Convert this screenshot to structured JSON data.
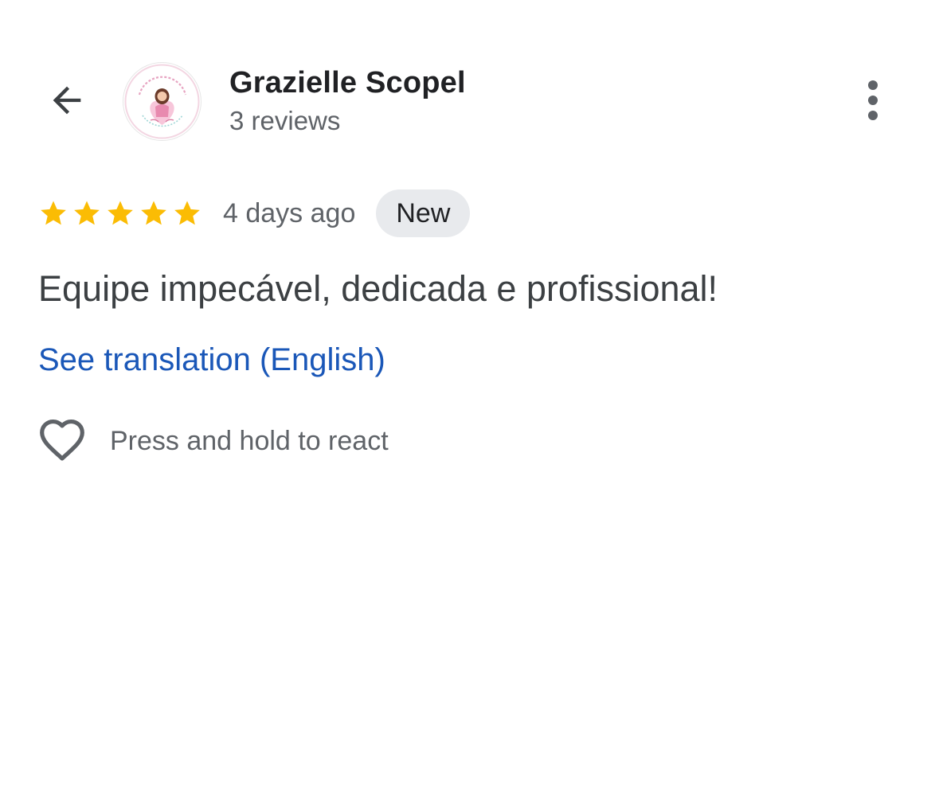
{
  "header": {
    "back_icon": "arrow-back-icon",
    "avatar_icon": "profile-avatar-icon",
    "reviewer_name": "Grazielle Scopel",
    "review_count": "3 reviews",
    "more_icon": "more-vertical-icon"
  },
  "review": {
    "rating": 5,
    "rating_max": 5,
    "star_icon": "star-icon",
    "star_color": "#fbbc04",
    "date": "4 days ago",
    "badge": "New",
    "text": "Equipe impecável, dedicada e profissional!",
    "translation_link": "See translation (English)",
    "link_color": "#1a57b8"
  },
  "reaction": {
    "icon": "heart-outline-icon",
    "hint": "Press and hold to react"
  }
}
